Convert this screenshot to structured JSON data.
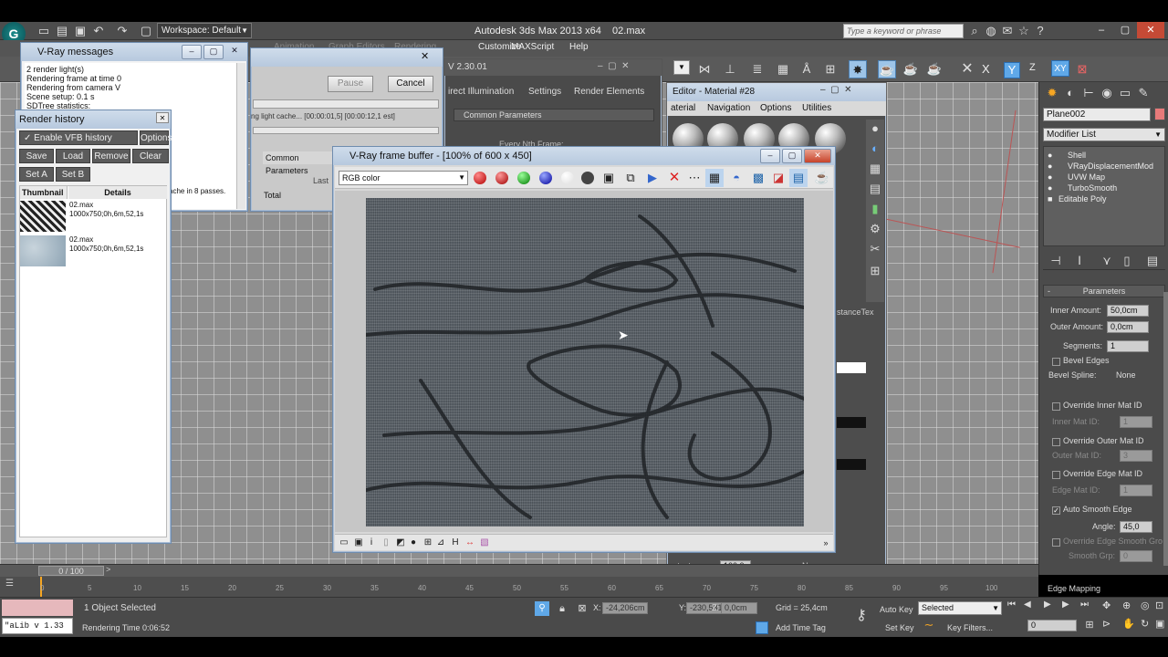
{
  "app": {
    "title": "Autodesk 3ds Max 2013 x64",
    "file": "02.max",
    "workspace": "Workspace: Default",
    "search_placeholder": "Type a keyword or phrase",
    "menu": [
      "Customize",
      "MAXScript",
      "Help"
    ],
    "menu_faint": [
      "Animation",
      "Graph Editors",
      "Rendering"
    ]
  },
  "vray_messages": {
    "title": "V-Ray messages",
    "lines": [
      "2 render light(s)",
      "Rendering frame at time 0",
      "Rendering from camera V",
      "Scene setup: 0.1 s",
      "SDTree statistics:"
    ]
  },
  "render_history": {
    "title": "Render history",
    "enable_label": "Enable VFB history",
    "options_label": "Options",
    "buttons": [
      "Save",
      "Load",
      "Remove",
      "Clear",
      "Set A",
      "Set B"
    ],
    "col_thumbnail": "Thumbnail",
    "col_details": "Details",
    "items": [
      {
        "name": "02.max",
        "details": "1000x750;0h,6m,52,1s"
      },
      {
        "name": "02.max",
        "details": "1000x750;0h,6m,52,1s"
      }
    ]
  },
  "render_progress": {
    "pause": "Pause",
    "cancel": "Cancel",
    "status": "ng light cache... [00:00:01,5] [00:00:12,1 est]",
    "common_params": "Common Parameters",
    "total": "Total",
    "last": "Last",
    "passes": "ache in 8 passes."
  },
  "render_setup": {
    "version": "V 2.30.01",
    "tabs": [
      "irect Illumination",
      "Settings",
      "Render Elements"
    ],
    "common_params": "Common Parameters",
    "every_nth": "Every Nth Frame:"
  },
  "material_editor": {
    "title": "Editor - Material #28",
    "menu": [
      "aterial",
      "Navigation",
      "Options",
      "Utilities"
    ],
    "side_label": "stanceTex"
  },
  "vfb": {
    "title": "V-Ray frame buffer - [100% of 600 x 450]",
    "channel": "RGB color",
    "icon_names": [
      "red-channel-icon",
      "green-channel-icon",
      "blue-channel-icon"
    ]
  },
  "command_panel": {
    "object_name": "Plane002",
    "modifier_list": "Modifier List",
    "stack": [
      "Shell",
      "VRayDisplacementMod",
      "UVW Map",
      "TurboSmooth",
      "Editable Poly"
    ],
    "params_title": "Parameters",
    "inner_amount_label": "Inner Amount:",
    "inner_amount": "50,0cm",
    "outer_amount_label": "Outer Amount:",
    "outer_amount": "0,0cm",
    "segments_label": "Segments:",
    "segments": "1",
    "bevel_edges": "Bevel Edges",
    "bevel_spline": "Bevel Spline:",
    "bevel_spline_value": "None",
    "override_inner": "Override Inner Mat ID",
    "inner_mat_id": "Inner Mat ID:",
    "inner_mat_value": "1",
    "override_outer": "Override Outer Mat ID",
    "outer_mat_id": "Outer Mat ID:",
    "outer_mat_value": "3",
    "override_edge": "Override Edge Mat ID",
    "edge_mat_id": "Edge Mat ID:",
    "edge_mat_value": "1",
    "auto_smooth": "Auto Smooth Edge",
    "angle_label": "Angle:",
    "angle": "45,0",
    "override_edge_smooth": "Override Edge Smooth Gro",
    "smooth_grp": "Smooth Grp:",
    "smooth_grp_value": "0",
    "edge_mapping": "Edge Mapping"
  },
  "mat_editor_bottom": {
    "texture": "e texture",
    "amount": "100,0",
    "none": "None"
  },
  "timeline": {
    "frame": "0 / 100",
    "ticks": [
      "0",
      "5",
      "10",
      "15",
      "20",
      "25",
      "30",
      "35",
      "40",
      "45",
      "50",
      "55",
      "60",
      "65",
      "70",
      "75",
      "80",
      "85",
      "90",
      "95",
      "100"
    ]
  },
  "status": {
    "script": "\"aLib v 1.33",
    "selection": "1 Object Selected",
    "render_time": "Rendering Time  0:06:52",
    "x_label": "X:",
    "x_value": "-24,206cm",
    "y_label": "Y:",
    "y_value": "-230,531cm",
    "z_label": "Z:",
    "z_value": "0,0cm",
    "grid": "Grid = 25,4cm",
    "add_time_tag": "Add Time Tag",
    "auto_key": "Auto Key",
    "selected": "Selected",
    "set_key": "Set Key",
    "key_filters": "Key Filters...",
    "frame_field": "0"
  },
  "toolbar": {
    "axes": [
      "X",
      "Y",
      "Z",
      "XY"
    ]
  }
}
